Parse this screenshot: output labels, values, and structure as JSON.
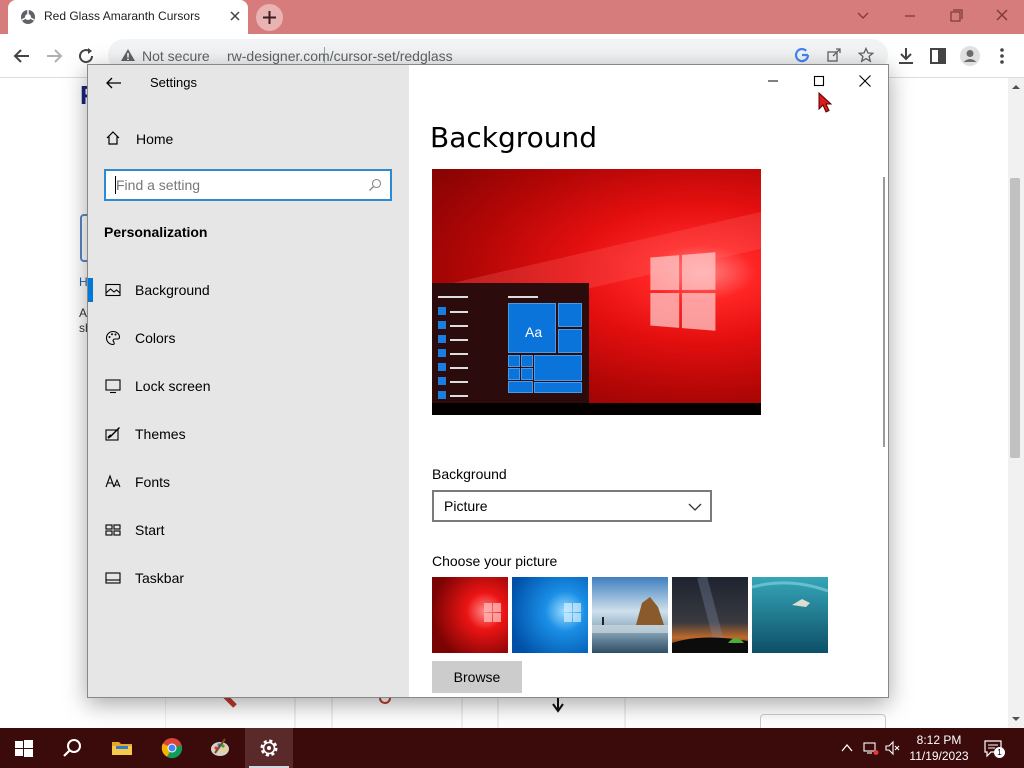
{
  "browser": {
    "tab_title": "Red Glass Amaranth Cursors",
    "not_secure": "Not secure",
    "url": "rw-designer.com/cursor-set/redglass"
  },
  "page": {
    "brand_letter": "R",
    "frag_h": "H",
    "frag_a": "A",
    "frag_s": "sh"
  },
  "settings": {
    "app_title": "Settings",
    "home": "Home",
    "search_placeholder": "Find a setting",
    "section": "Personalization",
    "nav_items": [
      {
        "label": "Background",
        "icon": "picture-icon"
      },
      {
        "label": "Colors",
        "icon": "palette-icon"
      },
      {
        "label": "Lock screen",
        "icon": "lock-screen-icon"
      },
      {
        "label": "Themes",
        "icon": "themes-icon"
      },
      {
        "label": "Fonts",
        "icon": "fonts-icon"
      },
      {
        "label": "Start",
        "icon": "start-icon"
      },
      {
        "label": "Taskbar",
        "icon": "taskbar-icon"
      }
    ],
    "page_title": "Background",
    "preview_tile_text": "Aa",
    "background_label": "Background",
    "background_value": "Picture",
    "choose_label": "Choose your picture",
    "browse_label": "Browse"
  },
  "taskbar": {
    "time": "8:12 PM",
    "date": "11/19/2023",
    "notification_count": "1"
  },
  "colors": {
    "tabstrip": "#d77c7c",
    "accent": "#0078d7",
    "taskbar": "#3b0a0a"
  }
}
